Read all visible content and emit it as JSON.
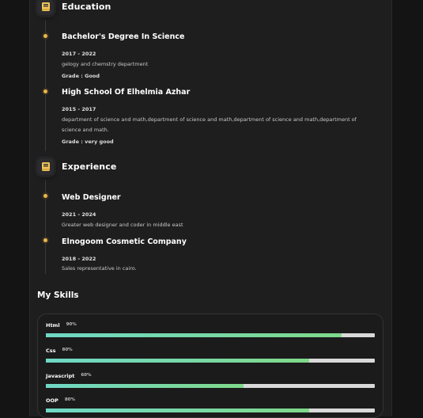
{
  "education": {
    "title": "Education",
    "icon": "book-icon",
    "items": [
      {
        "title": "Bachelor's Degree In Science",
        "years": "2017 - 2022",
        "text": "gelogy and chemstry department",
        "grade": "Grade : Good"
      },
      {
        "title": "High School Of Elhelmia Azhar",
        "years": "2015 - 2017",
        "text": "department of science and math,department of science and math,department of science and math,department of science and math.",
        "grade": "Grade : very good"
      }
    ]
  },
  "experience": {
    "title": "Experience",
    "icon": "book-icon",
    "items": [
      {
        "title": "Web Designer",
        "years": "2021 - 2024",
        "text": "Greater web designer and coder in middle east"
      },
      {
        "title": "Elnogoom Cosmetic Company",
        "years": "2018 - 2022",
        "text": "Sales representative in cairo."
      }
    ]
  },
  "skills": {
    "title": "My Skills",
    "items": [
      {
        "name": "Html",
        "percent_label": "90%",
        "level": 0.9
      },
      {
        "name": "Css",
        "percent_label": "80%",
        "level": 0.8
      },
      {
        "name": "Javascript",
        "percent_label": "60%",
        "level": 0.6
      },
      {
        "name": "OOP",
        "percent_label": "80%",
        "level": 0.8
      }
    ]
  },
  "colors": {
    "accent_dot": "#e8b64c",
    "icon_yellow": "#f1c65b",
    "bar_start": "#6fd8c6",
    "bar_end": "#7fd98a",
    "track": "#d9d9d9"
  }
}
